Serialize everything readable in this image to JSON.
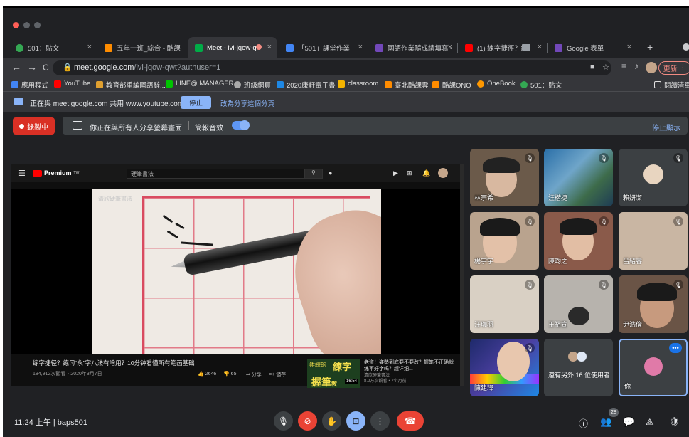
{
  "tabs": [
    {
      "title": "501：貼文",
      "close": "×",
      "color": "#34a853"
    },
    {
      "title": "五年一班_綜合 - 酷課",
      "close": "×",
      "color": "#ff8c00"
    },
    {
      "title": "Meet - ivi-jqow-q",
      "close": "×",
      "color": "#00ac47"
    },
    {
      "title": "「501」課堂作業",
      "close": "×",
      "color": "#4285f4"
    },
    {
      "title": "國語作業隨成績填寫 -",
      "close": "×",
      "color": "#7248b9"
    },
    {
      "title": "(1) 練字捷徑？練",
      "close": "×",
      "color": "#ff0000"
    },
    {
      "title": "Google 表單",
      "close": "×",
      "color": "#7248b9"
    }
  ],
  "new_tab": "+",
  "nav": {
    "back": "←",
    "forward": "→",
    "reload": "C",
    "url_host": "meet.google.com",
    "url_path": "/ivi-jqow-qwt?authuser=1",
    "update_label": "更新"
  },
  "bookmarks": [
    {
      "label": "應用程式",
      "color": "#4285f4"
    },
    {
      "label": "YouTube",
      "color": "#ff0000"
    },
    {
      "label": "教育部重編國語辭...",
      "color": "#e0a030"
    },
    {
      "label": "LINE@ MANAGER",
      "color": "#00c300"
    },
    {
      "label": "班級網頁",
      "color": "#aaaaaa"
    },
    {
      "label": "2020康軒電子書",
      "color": "#1e88e5"
    },
    {
      "label": "classroom",
      "color": "#f4b400"
    },
    {
      "label": "臺北酷課雲",
      "color": "#ff8c00"
    },
    {
      "label": "酷課ONO",
      "color": "#ff8c00"
    },
    {
      "label": "OneBook",
      "color": "#ff9800"
    },
    {
      "label": "501：貼文",
      "color": "#34a853"
    }
  ],
  "reading_list": "閱讀清單",
  "share_banner": {
    "text": "正在與 meet.google.com 共用 www.youtube.com",
    "stop": "停止",
    "switch": "改為分享這個分頁"
  },
  "meet": {
    "recording": "錄製中",
    "presenting_text": "你正在與所有人分享螢幕畫面",
    "audio_label": "簡報音效",
    "stop_presenting": "停止顯示"
  },
  "youtube": {
    "premium": "Premium",
    "premium_sup": "TW",
    "search_placeholder": "硬筆書法",
    "channel_watermark": "清欣硬筆書法",
    "video_title": "练字捷径？练习“永”字八法有啥用？10分钟看懂所有笔画基础",
    "video_meta": "184,912次觀看・2020年3月7日",
    "likes": "2646",
    "dislikes": "65",
    "share": "分享",
    "save": "儲存",
    "more": "...",
    "related_thumb_1": "難練的",
    "related_thumb_2": "練字",
    "related_thumb_3": "握筆",
    "related_thumb_4": "教",
    "related_duration": "16:54",
    "related_title": "老道！姿勢到底要不要改？握笔不正确就练不好字吗？超详细...",
    "related_channel": "清欣硬筆書法",
    "related_meta": "8.2万次觀看・7个月前"
  },
  "participants": [
    {
      "name": "林宗希",
      "muted": "🎤̸"
    },
    {
      "name": "汪楷捷",
      "muted": "🎤̸"
    },
    {
      "name": "賴妍潔",
      "muted": "🎤̸"
    },
    {
      "name": "楊宇宇",
      "muted": "🎤̸"
    },
    {
      "name": "陳昀之",
      "muted": "🎤̸"
    },
    {
      "name": "呂紹睿",
      "muted": "🎤̸"
    },
    {
      "name": "汪珈羽",
      "muted": "🎤̸"
    },
    {
      "name": "王裕宣",
      "muted": "🎤̸"
    },
    {
      "name": "尹浩倫",
      "muted": "🎤̸"
    },
    {
      "name": "陳建瑋",
      "muted": "🎤̸"
    }
  ],
  "others_tile": "還有另外 16 位使用者",
  "self_tile": "你",
  "bottom": {
    "time": "11:24 上午",
    "separator": "|",
    "meeting_code": "baps501",
    "participant_count": "28"
  },
  "colors": {
    "accent_blue": "#8ab4f8",
    "red": "#ea4335",
    "background": "#202124",
    "tile": "#3c4043"
  }
}
